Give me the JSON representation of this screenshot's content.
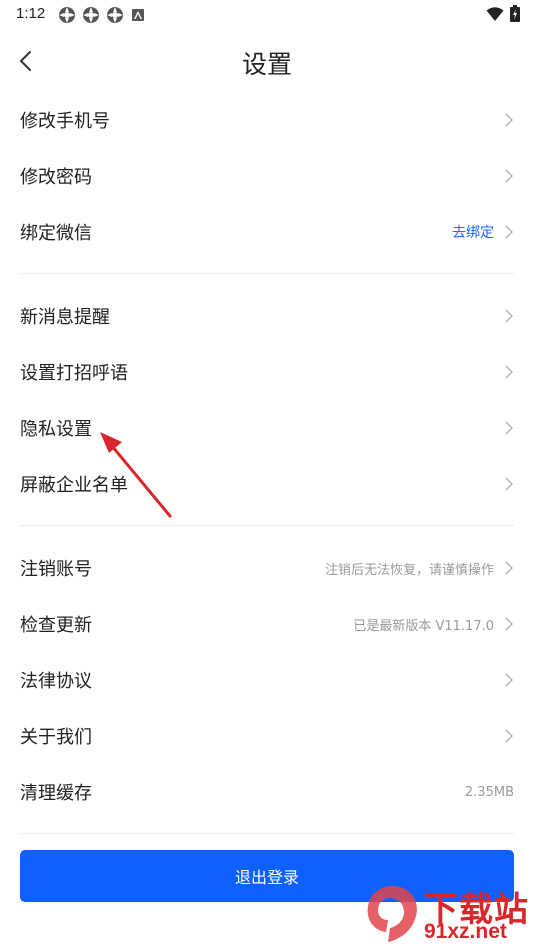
{
  "status_bar": {
    "time": "1:12",
    "left_icons": [
      "app-notification-icon",
      "app-notification-icon",
      "app-notification-icon",
      "accessibility-icon"
    ],
    "right_icons": [
      "wifi-icon",
      "battery-icon"
    ]
  },
  "header": {
    "title": "设置"
  },
  "groups": [
    {
      "items": [
        {
          "label": "修改手机号",
          "value": ""
        },
        {
          "label": "修改密码",
          "value": ""
        },
        {
          "label": "绑定微信",
          "value": "去绑定"
        }
      ]
    },
    {
      "items": [
        {
          "label": "新消息提醒",
          "value": ""
        },
        {
          "label": "设置打招呼语",
          "value": ""
        },
        {
          "label": "隐私设置",
          "value": ""
        },
        {
          "label": "屏蔽企业名单",
          "value": ""
        }
      ]
    },
    {
      "items": [
        {
          "label": "注销账号",
          "value": "注销后无法恢复，请谨慎操作"
        },
        {
          "label": "检查更新",
          "value": "已是最新版本 V11.17.0"
        },
        {
          "label": "法律协议",
          "value": ""
        },
        {
          "label": "关于我们",
          "value": ""
        },
        {
          "label": "清理缓存",
          "value": "2.35MB"
        }
      ]
    }
  ],
  "logout": {
    "label": "退出登录"
  },
  "watermark": {
    "text": "下载站",
    "url": "91xz.net"
  },
  "colors": {
    "accent": "#0f61ff",
    "link": "#1a66ff",
    "annotation_arrow": "#d9262b"
  }
}
